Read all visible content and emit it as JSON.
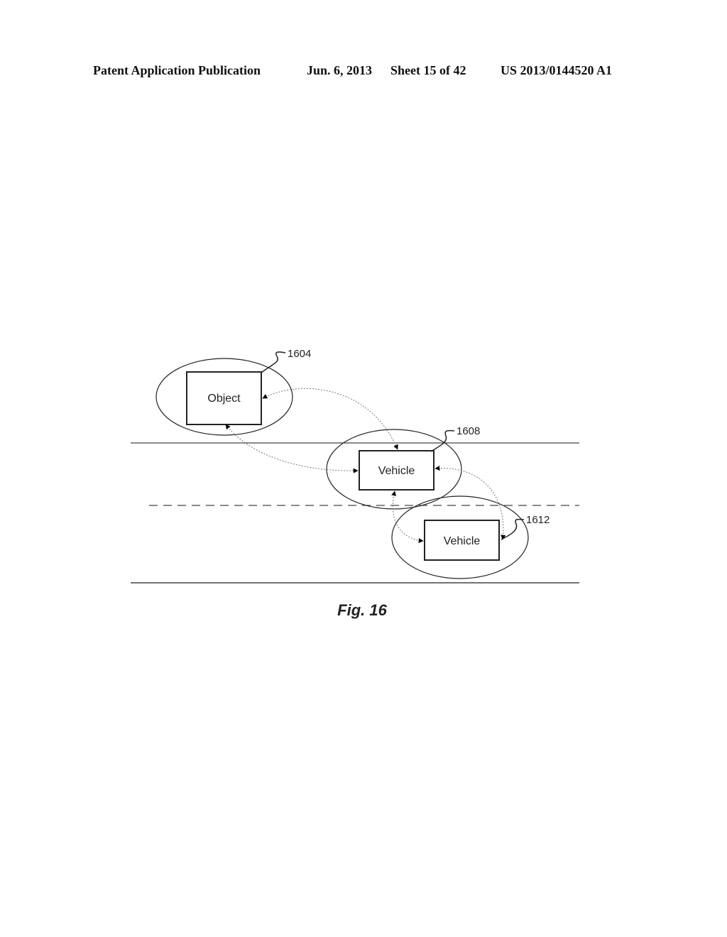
{
  "header": {
    "publication": "Patent Application Publication",
    "date": "Jun. 6, 2013",
    "sheet": "Sheet 15 of 42",
    "number": "US 2013/0144520 A1"
  },
  "figure": {
    "caption": "Fig. 16",
    "nodes": [
      {
        "id": "1604",
        "label": "Object",
        "ref": "1604"
      },
      {
        "id": "1608",
        "label": "Vehicle",
        "ref": "1608"
      },
      {
        "id": "1612",
        "label": "Vehicle",
        "ref": "1612"
      }
    ],
    "edges": [
      {
        "from": "1604",
        "to": "1608",
        "style": "dotted",
        "direction": "bidirectional"
      },
      {
        "from": "1604",
        "to": "1608",
        "style": "dotted",
        "direction": "bidirectional"
      },
      {
        "from": "1608",
        "to": "1612",
        "style": "dotted",
        "direction": "bidirectional"
      },
      {
        "from": "1608",
        "to": "1612",
        "style": "dotted",
        "direction": "bidirectional"
      }
    ],
    "road": {
      "lanes": 2,
      "divider": "dashed"
    }
  }
}
